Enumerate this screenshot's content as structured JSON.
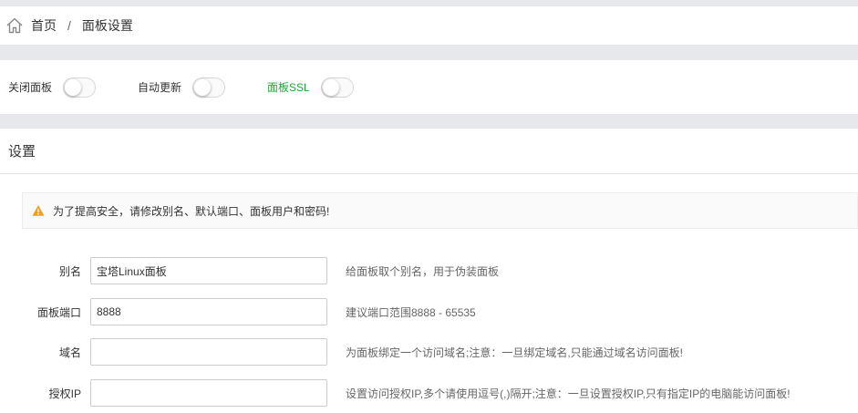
{
  "breadcrumb": {
    "home": "首页",
    "separator": "/",
    "current": "面板设置"
  },
  "toggles": [
    {
      "label": "关闭面板",
      "on": false
    },
    {
      "label": "自动更新",
      "on": false
    },
    {
      "label": "面板SSL",
      "on": false
    }
  ],
  "settings": {
    "title": "设置",
    "alert": "为了提高安全，请修改别名、默认端口、面板用户和密码!",
    "fields": [
      {
        "label": "别名",
        "value": "宝塔Linux面板",
        "hint": "给面板取个别名，用于伪装面板"
      },
      {
        "label": "面板端口",
        "value": "8888",
        "hint": "建议端口范围8888 - 65535"
      },
      {
        "label": "域名",
        "value": "",
        "hint": "为面板绑定一个访问域名;注意：一旦绑定域名,只能通过域名访问面板!"
      },
      {
        "label": "授权IP",
        "value": "",
        "hint": "设置访问授权IP,多个请使用逗号(,)隔开;注意：一旦设置授权IP,只有指定IP的电脑能访问面板!"
      }
    ]
  },
  "colors": {
    "accent_green": "#20a53a",
    "warning_orange": "#f0a020",
    "page_bg": "#e6e8ec"
  },
  "icons": {
    "home": "home-icon",
    "warning": "warning-icon"
  }
}
